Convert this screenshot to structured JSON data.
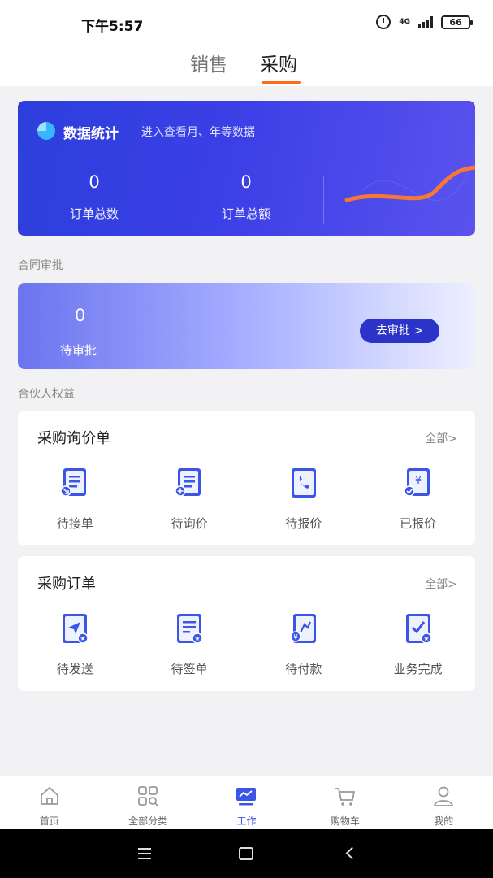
{
  "status": {
    "time": "下午5:57",
    "network": "4G",
    "battery": "66"
  },
  "tabs": [
    {
      "label": "销售"
    },
    {
      "label": "采购"
    }
  ],
  "stats": {
    "title": "数据统计",
    "subtitle": "进入查看月、年等数据",
    "items": [
      {
        "value": "0",
        "label": "订单总数"
      },
      {
        "value": "0",
        "label": "订单总额"
      }
    ]
  },
  "contract": {
    "section_label": "合同审批",
    "value": "0",
    "label": "待审批",
    "button": "去审批 >"
  },
  "partner_label": "合伙人权益",
  "inquiry": {
    "title": "采购询价单",
    "more": "全部>",
    "items": [
      {
        "label": "待接单",
        "icon": "pending-accept-icon"
      },
      {
        "label": "待询价",
        "icon": "pending-inquiry-icon"
      },
      {
        "label": "待报价",
        "icon": "pending-quote-icon"
      },
      {
        "label": "已报价",
        "icon": "quoted-icon"
      }
    ]
  },
  "orders": {
    "title": "采购订单",
    "more": "全部>",
    "items": [
      {
        "label": "待发送",
        "icon": "pending-send-icon"
      },
      {
        "label": "待签单",
        "icon": "pending-sign-icon"
      },
      {
        "label": "待付款",
        "icon": "pending-pay-icon"
      },
      {
        "label": "业务完成",
        "icon": "completed-icon"
      }
    ]
  },
  "nav": [
    {
      "label": "首页",
      "icon": "home-icon"
    },
    {
      "label": "全部分类",
      "icon": "category-icon"
    },
    {
      "label": "工作",
      "icon": "work-icon"
    },
    {
      "label": "购物车",
      "icon": "cart-icon"
    },
    {
      "label": "我的",
      "icon": "profile-icon"
    }
  ],
  "colors": {
    "accent": "#3c55e6",
    "tab_underline": "#ff6a1a",
    "stats_bg": "#3b3fe6"
  }
}
